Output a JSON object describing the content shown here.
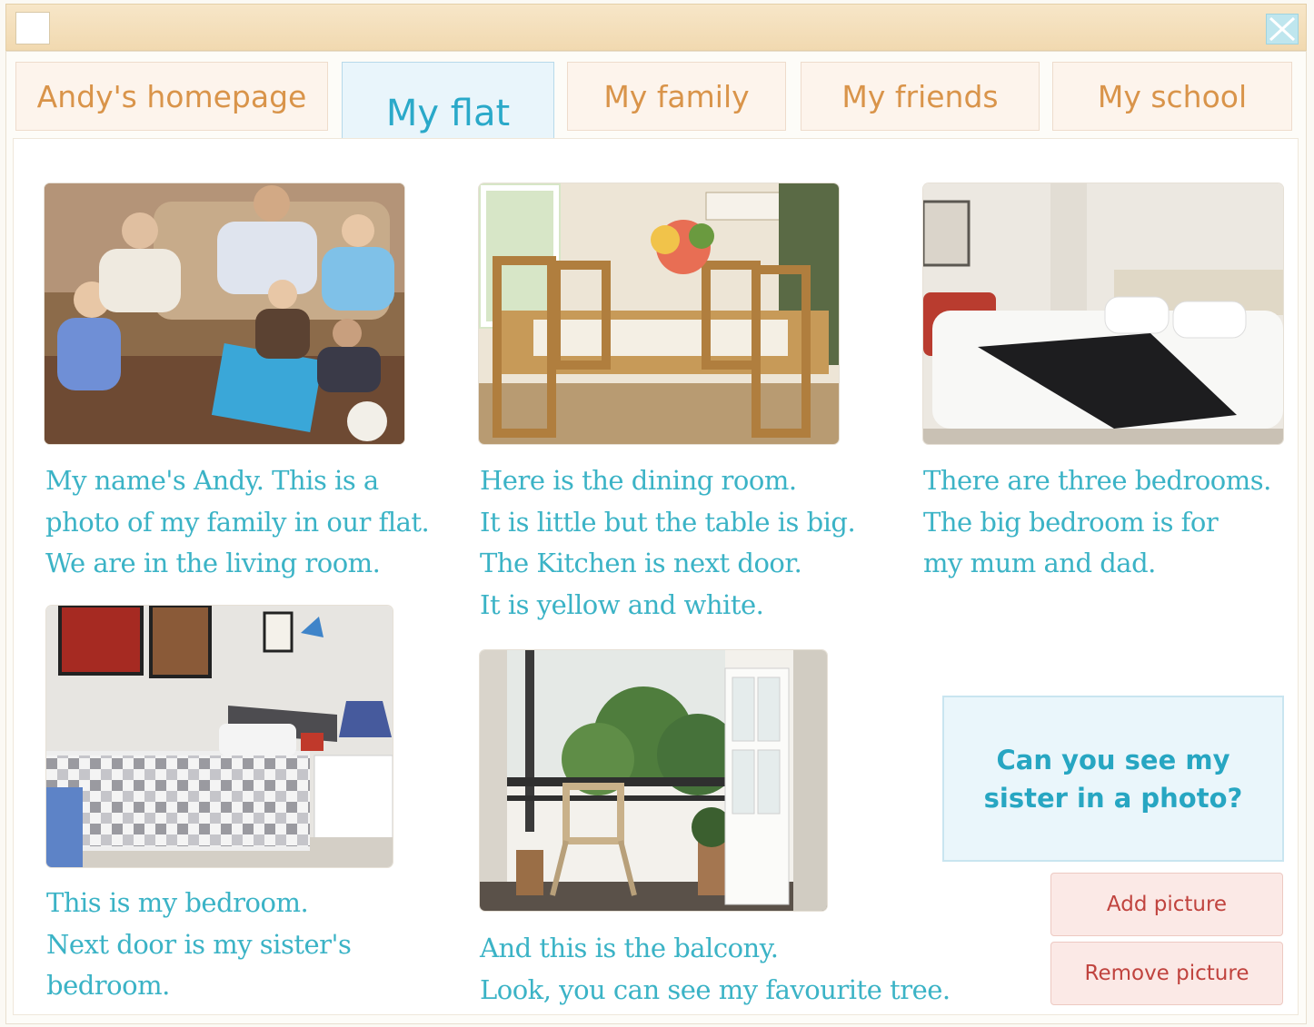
{
  "window": {
    "icon": "window-icon",
    "close_icon": "close-icon"
  },
  "tabs": [
    {
      "label": "Andy's homepage",
      "active": false
    },
    {
      "label": "My flat",
      "active": true
    },
    {
      "label": "My family",
      "active": false
    },
    {
      "label": "My friends",
      "active": false
    },
    {
      "label": "My school",
      "active": false
    }
  ],
  "photos": [
    {
      "name": "family-living-room-photo",
      "caption": "My name's Andy. This is a\nphoto of my family in our flat.\nWe are in the living room."
    },
    {
      "name": "dining-room-photo",
      "caption": "Here is the dining room.\nIt is little but the table is big.\nThe Kitchen is next door.\nIt is yellow and white."
    },
    {
      "name": "parents-bedroom-photo",
      "caption": "There are three bedrooms.\nThe big bedroom is for\nmy mum and dad."
    },
    {
      "name": "andy-bedroom-photo",
      "caption": "This is my bedroom.\nNext door is my sister's\nbedroom."
    },
    {
      "name": "balcony-photo",
      "caption": "And this is the balcony.\nLook, you can see my favourite tree."
    }
  ],
  "question": {
    "line1": "Can you see my",
    "line2": "sister in a photo?"
  },
  "buttons": {
    "add": "Add picture",
    "remove": "Remove picture"
  },
  "colors": {
    "caption_text": "#3bb3c6",
    "tab_text": "#d9944a",
    "active_tab_text": "#2aa9c9",
    "button_text": "#c0433e"
  }
}
